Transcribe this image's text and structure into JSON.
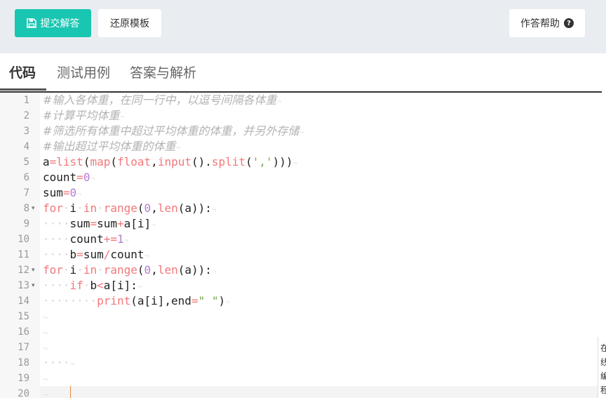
{
  "toolbar": {
    "submit_label": "提交解答",
    "reset_label": "还原模板",
    "help_label": "作答帮助",
    "submit_color": "#19c6b1"
  },
  "tabs": [
    {
      "label": "代码",
      "active": true
    },
    {
      "label": "测试用例",
      "active": false
    },
    {
      "label": "答案与解析",
      "active": false
    }
  ],
  "editor": {
    "lines": [
      {
        "n": "1",
        "text": "#输入各体重，在同一行中，以逗号间隔各体重"
      },
      {
        "n": "2",
        "text": "#计算平均体重"
      },
      {
        "n": "3",
        "text": "#筛选所有体重中超过平均体重的体重，并另外存储"
      },
      {
        "n": "4",
        "text": "#输出超过平均体重的体重"
      },
      {
        "n": "5",
        "text": "a=list(map(float,input().split(',')))"
      },
      {
        "n": "6",
        "text": "count=0"
      },
      {
        "n": "7",
        "text": "sum=0"
      },
      {
        "n": "8",
        "text": "for i in range(0,len(a)):",
        "fold": true
      },
      {
        "n": "9",
        "text": "    sum=sum+a[i]"
      },
      {
        "n": "10",
        "text": "    count+=1"
      },
      {
        "n": "11",
        "text": "    b=sum/count"
      },
      {
        "n": "12",
        "text": "for i in range(0,len(a)):",
        "fold": true
      },
      {
        "n": "13",
        "text": "    if b<a[i]:",
        "fold": true
      },
      {
        "n": "14",
        "text": "        print(a[i],end=\" \")"
      },
      {
        "n": "15",
        "text": ""
      },
      {
        "n": "16",
        "text": ""
      },
      {
        "n": "17",
        "text": ""
      },
      {
        "n": "18",
        "text": "    "
      },
      {
        "n": "19",
        "text": ""
      },
      {
        "n": "20",
        "text": ""
      }
    ]
  },
  "side_panel": {
    "text": "在线编程"
  }
}
